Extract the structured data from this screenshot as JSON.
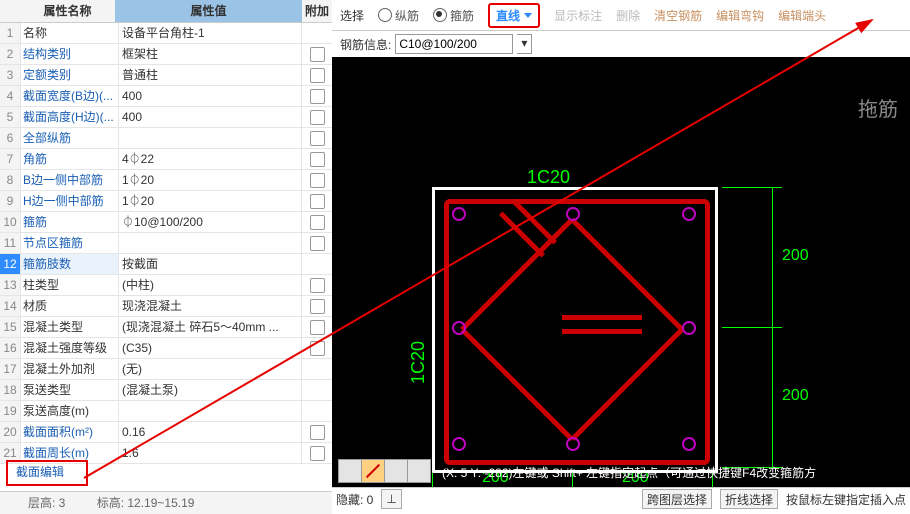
{
  "header": {
    "c1": "属性名称",
    "c2": "属性值",
    "c3": "附加"
  },
  "rows": [
    {
      "n": "1",
      "name": "名称",
      "val": "设备平台角柱-1",
      "link": false,
      "cb": false
    },
    {
      "n": "2",
      "name": "结构类别",
      "val": "框架柱",
      "link": true,
      "cb": true
    },
    {
      "n": "3",
      "name": "定额类别",
      "val": "普通柱",
      "link": true,
      "cb": true
    },
    {
      "n": "4",
      "name": "截面宽度(B边)(...",
      "val": "400",
      "link": true,
      "cb": true
    },
    {
      "n": "5",
      "name": "截面高度(H边)(...",
      "val": "400",
      "link": true,
      "cb": true
    },
    {
      "n": "6",
      "name": "全部纵筋",
      "val": "",
      "link": true,
      "cb": true
    },
    {
      "n": "7",
      "name": "角筋",
      "val": "4⏀22",
      "link": true,
      "cb": true
    },
    {
      "n": "8",
      "name": "B边一侧中部筋",
      "val": "1⏀20",
      "link": true,
      "cb": true
    },
    {
      "n": "9",
      "name": "H边一侧中部筋",
      "val": "1⏀20",
      "link": true,
      "cb": true
    },
    {
      "n": "10",
      "name": "箍筋",
      "val": "⏀10@100/200",
      "link": true,
      "cb": true
    },
    {
      "n": "11",
      "name": "节点区箍筋",
      "val": "",
      "link": true,
      "cb": true
    },
    {
      "n": "12",
      "name": "箍筋肢数",
      "val": "按截面",
      "link": true,
      "cb": false,
      "sel": true
    },
    {
      "n": "13",
      "name": "柱类型",
      "val": "(中柱)",
      "link": false,
      "cb": true
    },
    {
      "n": "14",
      "name": "材质",
      "val": "现浇混凝土",
      "link": false,
      "cb": true
    },
    {
      "n": "15",
      "name": "混凝土类型",
      "val": "(现浇混凝土    碎石5～40mm  ...",
      "link": false,
      "cb": true
    },
    {
      "n": "16",
      "name": "混凝土强度等级",
      "val": "(C35)",
      "link": false,
      "cb": true
    },
    {
      "n": "17",
      "name": "混凝土外加剂",
      "val": "(无)",
      "link": false,
      "cb": false
    },
    {
      "n": "18",
      "name": "泵送类型",
      "val": "(混凝土泵)",
      "link": false,
      "cb": false
    },
    {
      "n": "19",
      "name": "泵送高度(m)",
      "val": "",
      "link": false,
      "cb": false
    },
    {
      "n": "20",
      "name": "截面面积(m²)",
      "val": "0.16",
      "link": true,
      "cb": true
    },
    {
      "n": "21",
      "name": "截面周长(m)",
      "val": "1.6",
      "link": true,
      "cb": true
    }
  ],
  "sec_edit": "截面编辑",
  "footer": {
    "floor": "层高:  3",
    "elev": "标高:  12.19~15.19"
  },
  "toolbar": {
    "select": "选择",
    "zongjin": "纵筋",
    "gujin": "箍筋",
    "line": "直线",
    "showlabel": "显示标注",
    "delete": "删除",
    "clear": "清空钢筋",
    "editHook": "编辑弯钩",
    "editEnd": "编辑端头"
  },
  "info": {
    "label": "钢筋信息:",
    "value": "C10@100/200"
  },
  "toujin": "拖筋",
  "rebar": {
    "top": "1C20",
    "left": "1C20"
  },
  "dims": {
    "right1": "200",
    "right2": "200",
    "bot1": "200",
    "bot2": "200"
  },
  "coord": "(X: 5 Y: -282)左键或 Shift+ 左键指定起点（可通过快捷键F4改变箍筋方",
  "status": {
    "hidden": "隐藏:  0",
    "ortho": "⊥",
    "layerSel": "跨图层选择",
    "polySel": "折线选择",
    "mouseHint": "按鼠标左键指定插入点"
  }
}
